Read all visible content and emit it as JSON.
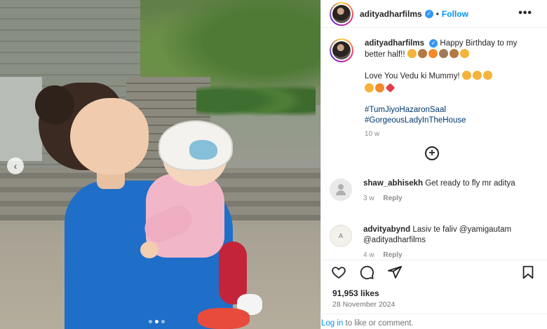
{
  "post": {
    "author": "adityadharfilms",
    "separator": "•",
    "follow_label": "Follow",
    "more_label": "•••"
  },
  "caption": {
    "author": "adityadharfilms",
    "line1": "Happy Birthday to my better half!!",
    "line2": "Love You Vedu ki Mummy!",
    "hashtag1": "#TumJiyoHazaronSaal",
    "hashtag2": "#GorgeousLadyInTheHouse",
    "time": "10 w"
  },
  "add_comment_label": "+",
  "comments": [
    {
      "username": "shaw_abhisekh",
      "text": "Get ready to fly mr aditya",
      "time": "3 w",
      "reply_label": "Reply"
    },
    {
      "username": "advityabynd",
      "text": "Lasiv te faliv @yamigautam @adityadharfilms",
      "time": "4 w",
      "reply_label": "Reply"
    }
  ],
  "stats": {
    "likes": "91,953 likes",
    "date": "28 November 2024"
  },
  "login": {
    "link": "Log in",
    "text": " to like or comment."
  },
  "carousel": {
    "prev_label": "‹",
    "dot_count": 3,
    "active_dot": 1
  },
  "colors": {
    "follow": "#0095f6",
    "verified": "#3897f0",
    "hashtag": "#00376b"
  },
  "icons": [
    "heart-icon",
    "comment-icon",
    "share-icon",
    "save-icon",
    "verified-icon",
    "more-icon",
    "add-comment-icon"
  ]
}
